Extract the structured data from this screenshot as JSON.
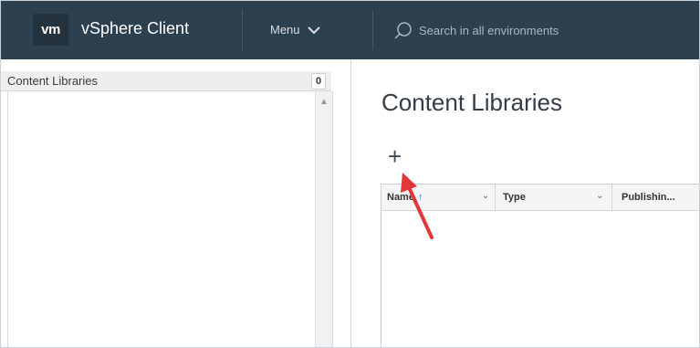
{
  "header": {
    "logo": "vm",
    "app_title": "vSphere Client",
    "menu_label": "Menu",
    "search_placeholder": "Search in all environments"
  },
  "sidebar": {
    "title": "Content Libraries",
    "count": "0"
  },
  "main": {
    "title": "Content Libraries",
    "add_label": "+",
    "columns": [
      {
        "label": "Name",
        "sorted": "ascending"
      },
      {
        "label": "Type"
      },
      {
        "label": "Publishin..."
      }
    ]
  },
  "colors": {
    "header_bg": "#2d4050",
    "sort_arrow": "#1e88e5",
    "annotation_arrow": "#e0373b"
  }
}
